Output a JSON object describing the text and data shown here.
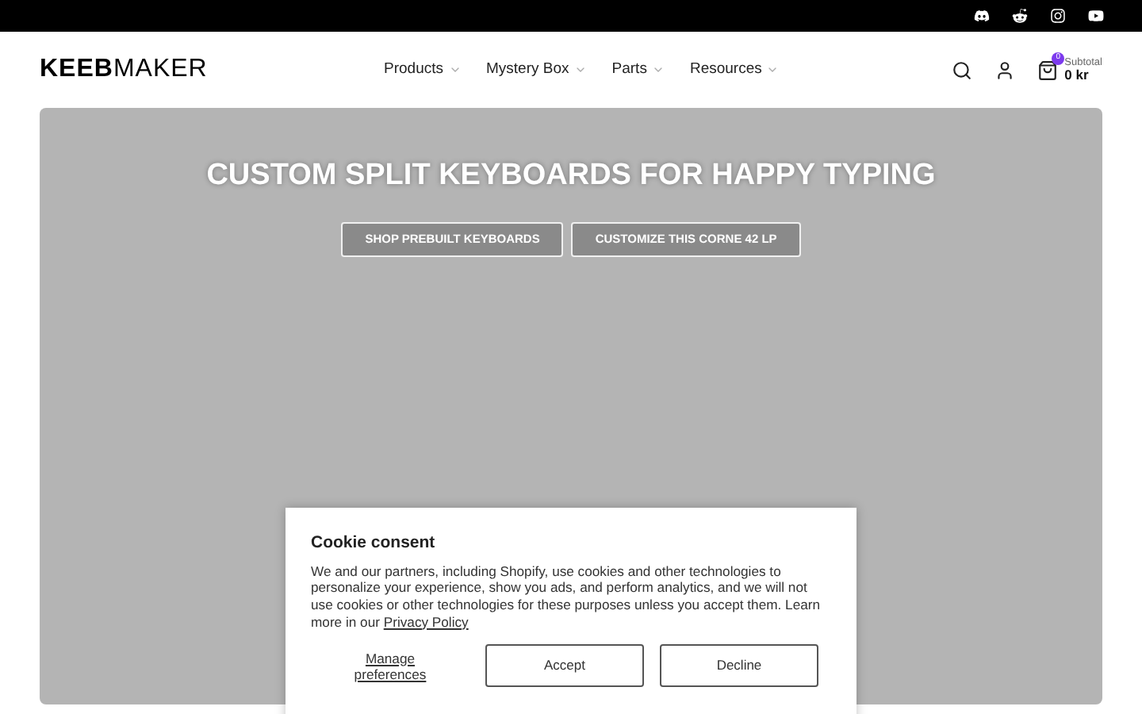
{
  "social_links": [
    {
      "kind": "discord"
    },
    {
      "kind": "reddit"
    },
    {
      "kind": "instagram"
    },
    {
      "kind": "youtube"
    }
  ],
  "header": {
    "logo": "**KEEB**MAKER",
    "nav": [
      {
        "label": "Products"
      },
      {
        "label": "Mystery Box"
      },
      {
        "label": "Parts"
      },
      {
        "label": "Resources"
      }
    ],
    "cart": {
      "count": "0",
      "subtotal_label": "Subtotal",
      "subtotal": "0 kr"
    }
  },
  "hero": {
    "title": "CUSTOM SPLIT KEYBOARDS FOR HAPPY TYPING",
    "buttons": [
      "SHOP PREBUILT KEYBOARDS",
      "CUSTOMIZE THIS CORNE 42 LP"
    ]
  },
  "cookie_consent": {
    "title": "Cookie consent",
    "text": "We and our partners, including Shopify, use cookies and other technologies to personalize your experience, show you ads, and perform analytics, and we will not use cookies or other technologies for these purposes unless you accept them. Learn more in our",
    "link": "Privacy Policy",
    "manage": "Manage preferences",
    "accept": "Accept",
    "decline": "Decline"
  }
}
